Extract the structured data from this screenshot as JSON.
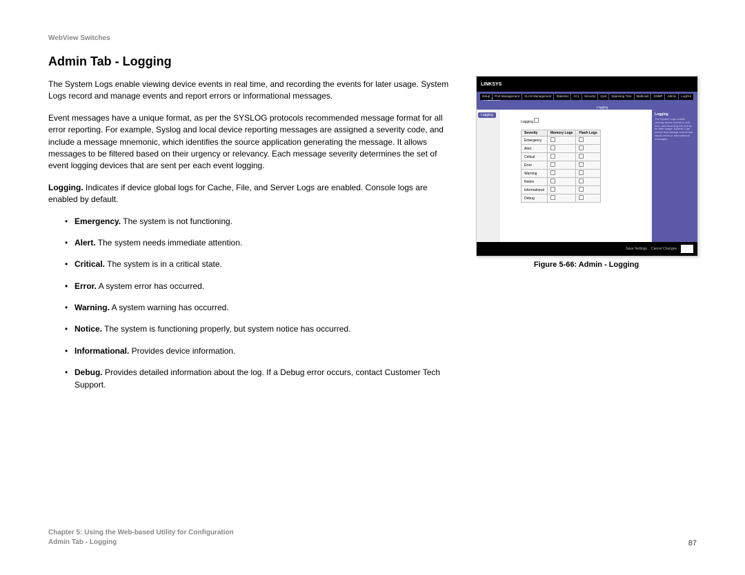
{
  "header": {
    "product_line": "WebView Switches"
  },
  "section": {
    "title": "Admin Tab - Logging"
  },
  "body": {
    "p1": "The System Logs enable viewing device events in real time, and recording the events for later usage. System Logs record and manage events and report errors or informational messages.",
    "p2": "Event messages have a unique format, as per the SYSLOG protocols recommended message format for all error reporting. For example, Syslog and local device reporting messages are assigned a severity code, and include a message mnemonic, which identifies the source application generating the message. It allows messages to be filtered based on their urgency or relevancy. Each message severity determines the set of event logging devices that are sent per each event logging.",
    "p3_term": "Logging.",
    "p3_text": " Indicates if device global logs for Cache, File, and Server Logs are enabled. Console logs are enabled by default.",
    "items": [
      {
        "term": "Emergency.",
        "text": " The system is not functioning."
      },
      {
        "term": "Alert.",
        "text": " The system needs immediate attention."
      },
      {
        "term": "Critical.",
        "text": " The system is in a critical state."
      },
      {
        "term": "Error.",
        "text": " A system error has occurred."
      },
      {
        "term": "Warning.",
        "text": " A system warning has occurred."
      },
      {
        "term": "Notice.",
        "text": " The system is functioning properly, but system notice has occurred."
      },
      {
        "term": "Informational.",
        "text": " Provides device information."
      },
      {
        "term": "Debug.",
        "text": " Provides detailed information about the log. If a Debug error occurs, contact Customer Tech Support."
      }
    ]
  },
  "figure": {
    "caption": "Figure 5-66: Admin - Logging",
    "nav": {
      "brand": "LINKSYS",
      "tabs": [
        "Setup",
        "Port Management",
        "VLAN Management",
        "Statistics",
        "ACL",
        "Security",
        "QoS",
        "Spanning Tree",
        "Multicast",
        "SNMP",
        "Admin",
        "LogOut"
      ],
      "subtabs_left": "",
      "sub_active": "Logging",
      "admin_label": "Admin",
      "side_tab": "Logging"
    },
    "center": {
      "logging_label": "Logging",
      "columns": [
        "Severity",
        "Memory Logs",
        "Flash Logs"
      ],
      "rows": [
        "Emergency",
        "Alert",
        "Critical",
        "Error",
        "Warning",
        "Notice",
        "Informational",
        "Debug"
      ]
    },
    "help": {
      "title": "Logging",
      "text": "The System Logs enable viewing device events in real time, and recording the events for later usage. System Logs record and manage events and report errors or informational messages."
    },
    "footer": {
      "save": "Save Settings",
      "cancel": "Cancel Changes"
    }
  },
  "footer": {
    "chapter": "Chapter 5: Using the Web-based Utility for Configuration",
    "section": "Admin Tab - Logging",
    "page": "87"
  }
}
